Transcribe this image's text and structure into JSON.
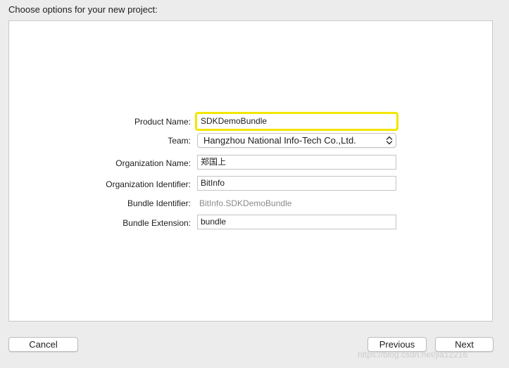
{
  "header": {
    "title": "Choose options for your new project:"
  },
  "form": {
    "product_name": {
      "label": "Product Name:",
      "value": "SDKDemoBundle"
    },
    "team": {
      "label": "Team:",
      "value": "Hangzhou National Info-Tech Co.,Ltd."
    },
    "organization_name": {
      "label": "Organization Name:",
      "value": "郑国上"
    },
    "organization_identifier": {
      "label": "Organization Identifier:",
      "value": "BitInfo"
    },
    "bundle_identifier": {
      "label": "Bundle Identifier:",
      "value": "BitInfo.SDKDemoBundle"
    },
    "bundle_extension": {
      "label": "Bundle Extension:",
      "value": "bundle"
    }
  },
  "footer": {
    "cancel_label": "Cancel",
    "previous_label": "Previous",
    "next_label": "Next"
  },
  "watermark": "https://blog.csdn.net/jia12216",
  "colors": {
    "focus_ring": "#f2e600",
    "window_background": "#ececec",
    "panel_background": "#ffffff"
  },
  "icons": {
    "select_arrows": "chevron-up-down-icon"
  }
}
